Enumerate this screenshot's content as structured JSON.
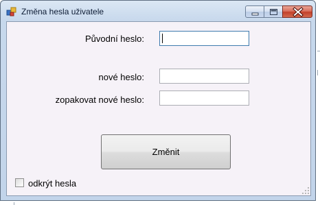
{
  "window": {
    "title": "Změna hesla uživatele"
  },
  "form": {
    "old_password_label": "Původní heslo:",
    "old_password_value": "",
    "new_password_label": "nové heslo:",
    "new_password_value": "",
    "repeat_password_label": "zopakovat nové heslo:",
    "repeat_password_value": "",
    "submit_label": "Změnit",
    "show_passwords_label": "odkrýt hesla",
    "show_passwords_checked": false
  },
  "colors": {
    "client_background": "#f6f2f8",
    "focus_border": "#3d7bad",
    "close_button": "#c2402a"
  }
}
